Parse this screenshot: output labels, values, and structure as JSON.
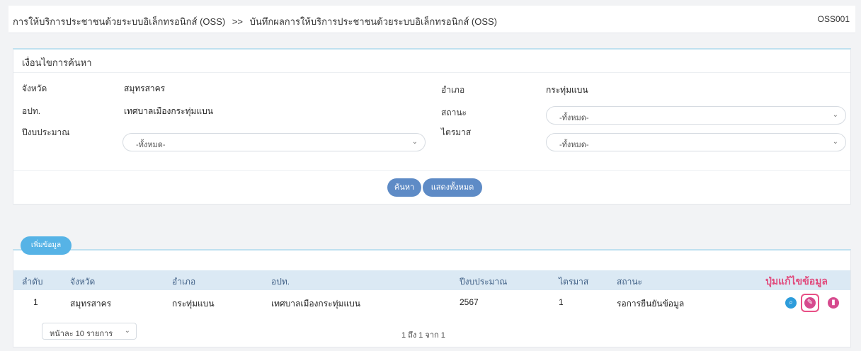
{
  "header": {
    "breadcrumb_parent": "การให้บริการประชาชนด้วยระบบอิเล็กทรอนิกส์ (OSS)",
    "breadcrumb_sep": ">>",
    "breadcrumb_current": "บันทึกผลการให้บริการประชาชนด้วยระบบอิเล็กทรอนิกส์ (OSS)",
    "page_code": "OSS001"
  },
  "search": {
    "title": "เงื่อนไขการค้นหา",
    "province_label": "จังหวัด",
    "province_value": "สมุทรสาคร",
    "district_label": "อำเภอ",
    "district_value": "กระทุ่มแบน",
    "org_label": "อปท.",
    "org_value": "เทศบาลเมืองกระทุ่มแบน",
    "status_label": "สถานะ",
    "status_value": "-ทั้งหมด-",
    "budget_label": "ปีงบประมาณ",
    "budget_value": "-ทั้งหมด-",
    "quarter_label": "ไตรมาส",
    "quarter_value": "-ทั้งหมด-",
    "search_button": "ค้นหา",
    "show_all_button": "แสดงทั้งหมด"
  },
  "list": {
    "add_button": "เพิ่มข้อมูล",
    "columns": [
      "ลำดับ",
      "จังหวัด",
      "อำเภอ",
      "อปท.",
      "ปีงบประมาณ",
      "ไตรมาส",
      "สถานะ",
      "ปุ่มแก้ไขข้อมูล"
    ],
    "rows": [
      {
        "no": "1",
        "province": "สมุทรสาคร",
        "district": "กระทุ่มแบน",
        "org": "เทศบาลเมืองกระทุ่มแบน",
        "year": "2567",
        "quarter": "1",
        "status": "รอการยืนยันข้อมูล"
      }
    ],
    "page_size": "หน้าละ 10 รายการ",
    "page_info": "1 ถึง 1 จาก 1"
  },
  "icons": {
    "view": "search-icon",
    "edit": "edit-icon",
    "delete": "delete-icon"
  }
}
